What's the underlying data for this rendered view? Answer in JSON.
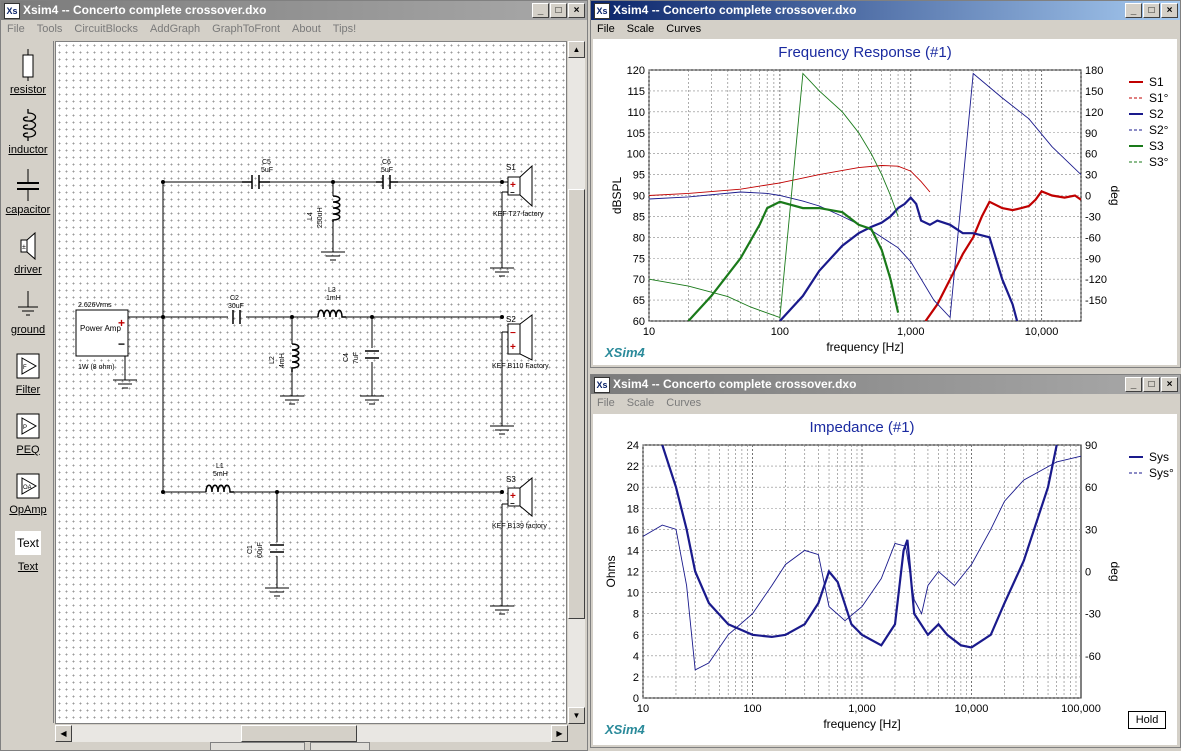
{
  "main_window": {
    "title": "Xsim4 -- Concerto complete crossover.dxo",
    "menu": [
      "File",
      "Tools",
      "CircuitBlocks",
      "AddGraph",
      "GraphToFront",
      "About",
      "Tips!"
    ]
  },
  "toolbox": [
    "resistor",
    "inductor",
    "capacitor",
    "driver",
    "ground",
    "Filter",
    "PEQ",
    "OpAmp",
    "Text"
  ],
  "toolbox_text_icon": "Text",
  "schematic": {
    "source_label": "2.626Vrms",
    "source_name": "Power Amp",
    "source_power": "1W (8 ohm)",
    "plus": "+",
    "minus": "−",
    "components": {
      "C5_name": "C5",
      "C5_val": "5uF",
      "C6_name": "C6",
      "C6_val": "5uF",
      "L4_name": "L4",
      "L4_val": "250uH",
      "C2_name": "C2",
      "C2_val": "30uF",
      "L3_name": "L3",
      "L3_val": "1mH",
      "L2_name": "L2",
      "L2_val": "4mH",
      "C4_name": "C4",
      "C4_val": "7uF",
      "L1_name": "L1",
      "L1_val": "5mH",
      "C1_name": "C1",
      "C1_val": "60uF"
    },
    "drivers": [
      {
        "id": "S1",
        "label": "KEF T27 factory"
      },
      {
        "id": "S2",
        "label": "KEF B110 Factory"
      },
      {
        "id": "S3",
        "label": "KEF B139 factory"
      }
    ]
  },
  "freq_window": {
    "title": "Xsim4 -- Concerto complete crossover.dxo",
    "menu": [
      "File",
      "Scale",
      "Curves"
    ],
    "chart_data": {
      "type": "line",
      "title": "Frequency Response (#1)",
      "xlabel": "frequency [Hz]",
      "ylabel": "dBSPL",
      "y2label": "deg",
      "x_scale": "log",
      "xlim": [
        10,
        20000
      ],
      "ylim": [
        60,
        120
      ],
      "y2lim": [
        -180,
        180
      ],
      "x_ticks": [
        "10",
        "100",
        "1,000",
        "10,000"
      ],
      "y_ticks": [
        "60",
        "65",
        "70",
        "75",
        "80",
        "85",
        "90",
        "95",
        "100",
        "105",
        "110",
        "115",
        "120"
      ],
      "y2_ticks": [
        "-150",
        "-120",
        "-90",
        "-60",
        "-30",
        "0",
        "30",
        "60",
        "90",
        "120",
        "150",
        "180"
      ],
      "watermark": "XSim4",
      "legend_position": "right",
      "series": [
        {
          "name": "S1",
          "color": "#c00000",
          "style": "solid",
          "axis": "left",
          "x": [
            1300,
            1600,
            2000,
            2500,
            3000,
            3500,
            4000,
            5000,
            6000,
            7000,
            8000,
            9000,
            10000,
            12000,
            15000,
            18000,
            20000
          ],
          "y": [
            60,
            64,
            70,
            76,
            80,
            85,
            88.5,
            87,
            86.5,
            87,
            87.5,
            89,
            91,
            90,
            89.5,
            90,
            89
          ]
        },
        {
          "name": "S1°",
          "color": "#c00000",
          "style": "dashed",
          "axis": "right",
          "x": [
            10,
            20,
            50,
            100,
            200,
            400,
            600,
            800,
            1000,
            1200,
            1400
          ],
          "y": [
            0,
            3,
            9,
            18,
            30,
            40,
            43,
            42,
            35,
            20,
            5
          ]
        },
        {
          "name": "S2",
          "color": "#1a1a8c",
          "style": "solid",
          "axis": "left",
          "x": [
            100,
            150,
            200,
            300,
            400,
            500,
            600,
            700,
            800,
            900,
            1000,
            1100,
            1200,
            1400,
            1600,
            2000,
            2500,
            3000,
            4000,
            5000,
            6000,
            6500
          ],
          "y": [
            60,
            66,
            72,
            78,
            81,
            82.5,
            83.5,
            85,
            87,
            88,
            89.5,
            88,
            84,
            83,
            84,
            83,
            81,
            81,
            80,
            70,
            64,
            60
          ]
        },
        {
          "name": "S2°",
          "color": "#1a1a8c",
          "style": "dashed",
          "axis": "right",
          "x": [
            10,
            20,
            50,
            80,
            100,
            150,
            200,
            300,
            500,
            800,
            1000,
            1500,
            2000,
            3000,
            5000,
            8000,
            12000,
            20000
          ],
          "y": [
            -5,
            -2,
            5,
            3,
            0,
            -8,
            -15,
            -30,
            -50,
            -75,
            -95,
            -150,
            -175,
            175,
            140,
            110,
            70,
            30
          ]
        },
        {
          "name": "S3",
          "color": "#1a7a1a",
          "style": "solid",
          "axis": "left",
          "x": [
            20,
            30,
            50,
            70,
            80,
            100,
            150,
            200,
            300,
            400,
            500,
            600,
            700,
            800
          ],
          "y": [
            60,
            66,
            75,
            83,
            87,
            88.5,
            87,
            87,
            86,
            83,
            82,
            77,
            70,
            62
          ]
        },
        {
          "name": "S3°",
          "color": "#1a7a1a",
          "style": "dashed",
          "axis": "right",
          "x": [
            10,
            20,
            40,
            60,
            100,
            150,
            200,
            300,
            400,
            500,
            600,
            700,
            800
          ],
          "y": [
            -120,
            -130,
            -145,
            -160,
            -175,
            175,
            150,
            120,
            90,
            60,
            30,
            0,
            -30
          ]
        }
      ]
    }
  },
  "imp_window": {
    "title": "Xsim4 -- Concerto complete crossover.dxo",
    "menu": [
      "File",
      "Scale",
      "Curves"
    ],
    "hold_button": "Hold",
    "chart_data": {
      "type": "line",
      "title": "Impedance (#1)",
      "xlabel": "frequency [Hz]",
      "ylabel": "Ohms",
      "y2label": "deg",
      "x_scale": "log",
      "xlim": [
        10,
        100000
      ],
      "ylim": [
        0,
        24
      ],
      "y2lim": [
        -90,
        90
      ],
      "x_ticks": [
        "10",
        "100",
        "1,000",
        "10,000",
        "100,000"
      ],
      "y_ticks": [
        "0",
        "2",
        "4",
        "6",
        "8",
        "10",
        "12",
        "14",
        "16",
        "18",
        "20",
        "22",
        "24"
      ],
      "y2_ticks": [
        "-60",
        "-30",
        "0",
        "30",
        "60",
        "90"
      ],
      "watermark": "XSim4",
      "legend_position": "right",
      "series": [
        {
          "name": "Sys",
          "color": "#1a1a8c",
          "style": "solid",
          "axis": "left",
          "x": [
            15,
            20,
            25,
            30,
            40,
            60,
            100,
            150,
            200,
            300,
            400,
            500,
            600,
            800,
            1000,
            1500,
            2000,
            2400,
            2600,
            3000,
            4000,
            5000,
            6000,
            8000,
            10000,
            15000,
            20000,
            30000,
            50000,
            60000
          ],
          "y": [
            24,
            20,
            16,
            12,
            9,
            7,
            6,
            5.8,
            6,
            7,
            9,
            12,
            11,
            7,
            6,
            5,
            7,
            14,
            15,
            8,
            6,
            7,
            6,
            5,
            4.8,
            6,
            9,
            13,
            20,
            24
          ]
        },
        {
          "name": "Sys°",
          "color": "#1a1a8c",
          "style": "dashed",
          "axis": "right",
          "x": [
            10,
            15,
            20,
            25,
            30,
            40,
            60,
            100,
            150,
            200,
            300,
            400,
            500,
            700,
            1000,
            1500,
            2000,
            2500,
            3000,
            3500,
            4000,
            5000,
            7000,
            10000,
            15000,
            20000,
            30000,
            60000,
            100000
          ],
          "y": [
            25,
            33,
            30,
            -10,
            -70,
            -65,
            -45,
            -30,
            -10,
            5,
            15,
            12,
            -25,
            -35,
            -25,
            -5,
            20,
            18,
            -20,
            -30,
            -10,
            0,
            -10,
            5,
            30,
            50,
            65,
            78,
            82
          ]
        }
      ]
    }
  }
}
